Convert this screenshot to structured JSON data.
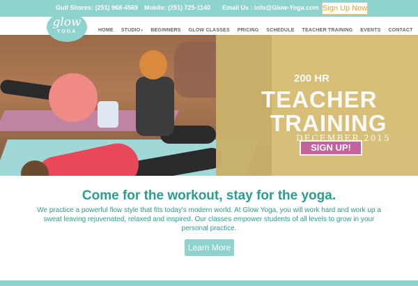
{
  "topbar": {
    "gulf": "Gulf Shores: (251) 968-4569",
    "mobile": "Mobile: (251) 725-1140",
    "email": "Email Us : Info@Glow-Yoga.com",
    "signup": "Sign Up Now"
  },
  "logo": {
    "top": "glow",
    "bottom": "YOGA"
  },
  "nav": {
    "items": [
      "HOME",
      "STUDIO",
      "BEGINNERS",
      "GLOW CLASSES",
      "PRICING",
      "SCHEDULE",
      "TEACHER TRAINING",
      "EVENTS",
      "CONTACT"
    ],
    "studio_caret": "▾"
  },
  "promo": {
    "line1": "200 HR",
    "line2": "TEACHER",
    "line3": "TRAINING",
    "line4": "DECEMBER 2015",
    "cta": "SIGN UP!"
  },
  "content": {
    "headline": "Come for the workout, stay for the yoga.",
    "body": "We practice a powerful flow style that fits today's modern world. At Glow Yoga, you will work hard and work up a sweat leaving rejuvenated, relaxed and inspired. Our classes empower students of all levels to grow in your personal practice.",
    "button": "Learn More"
  },
  "colors": {
    "accent": "#8fd3cf",
    "text_teal": "#2a9d8f",
    "promo_pink": "#c4649e",
    "promo_gold": "#d9c27a"
  }
}
